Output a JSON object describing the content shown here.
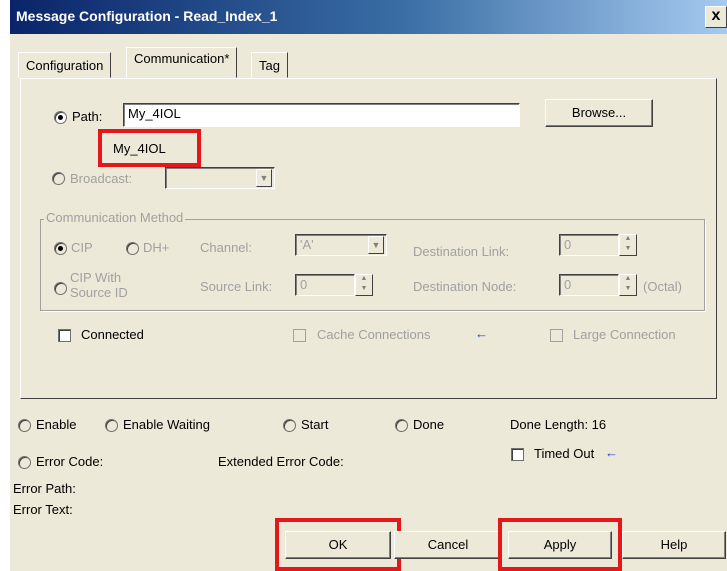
{
  "window": {
    "title": "Message Configuration - Read_Index_1",
    "close_glyph": "x"
  },
  "tabs": [
    {
      "label": "Configuration",
      "active": false
    },
    {
      "label": "Communication*",
      "active": true
    },
    {
      "label": "Tag",
      "active": false
    }
  ],
  "path": {
    "label": "Path:",
    "value": "My_4IOL",
    "resolved": "My_4IOL",
    "browse": "Browse..."
  },
  "broadcast": {
    "label": "Broadcast:",
    "value": ""
  },
  "comm_method": {
    "title": "Communication Method",
    "cip": "CIP",
    "dh": "DH+",
    "cip_with_source_1": "CIP With",
    "cip_with_source_2": "Source ID",
    "channel_label": "Channel:",
    "channel_value": "'A'",
    "source_link_label": "Source Link:",
    "source_link_value": "0",
    "dest_link_label": "Destination Link:",
    "dest_link_value": "0",
    "dest_node_label": "Destination Node:",
    "dest_node_value": "0",
    "octal": "(Octal)"
  },
  "options": {
    "connected": "Connected",
    "cache_connections": "Cache Connections",
    "large_connection": "Large Connection"
  },
  "status": {
    "enable": "Enable",
    "enable_waiting": "Enable Waiting",
    "start": "Start",
    "done": "Done",
    "done_length": "Done Length: 16",
    "error_code": "Error Code:",
    "extended_error_code": "Extended Error Code:",
    "timed_out": "Timed Out",
    "error_path": "Error Path:",
    "error_text": "Error Text:"
  },
  "buttons": {
    "ok": "OK",
    "cancel": "Cancel",
    "apply": "Apply",
    "help": "Help"
  },
  "icons": {
    "arrow": "←"
  },
  "colors": {
    "highlight": "#e4171b",
    "arrow": "#1c3fd6",
    "title_bar": "#0a246a"
  }
}
